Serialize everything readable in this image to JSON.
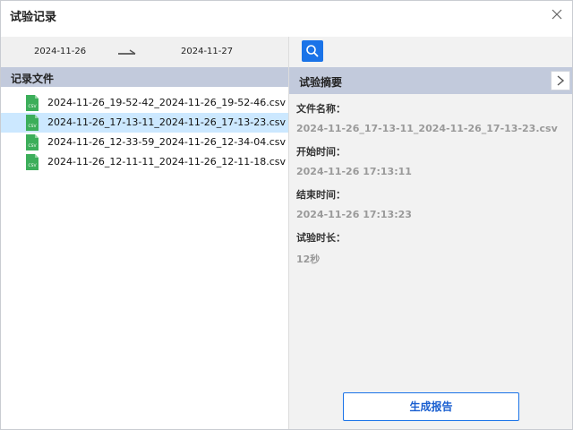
{
  "window": {
    "title": "试验记录"
  },
  "date_range": {
    "from": "2024-11-26",
    "to": "2024-11-27"
  },
  "left_panel": {
    "header": "记录文件",
    "files": [
      {
        "name": "2024-11-26_19-52-42_2024-11-26_19-52-46.csv",
        "selected": false
      },
      {
        "name": "2024-11-26_17-13-11_2024-11-26_17-13-23.csv",
        "selected": true
      },
      {
        "name": "2024-11-26_12-33-59_2024-11-26_12-34-04.csv",
        "selected": false
      },
      {
        "name": "2024-11-26_12-11-11_2024-11-26_12-11-18.csv",
        "selected": false
      }
    ]
  },
  "right_panel": {
    "header": "试验摘要",
    "fields": [
      {
        "label": "文件名称：",
        "value": "2024-11-26_17-13-11_2024-11-26_17-13-23.csv"
      },
      {
        "label": "开始时间：",
        "value": "2024-11-26 17:13:11"
      },
      {
        "label": "结束时间：",
        "value": "2024-11-26 17:13:23"
      },
      {
        "label": "试验时长：",
        "value": "12秒"
      }
    ],
    "report_button": "生成报告"
  },
  "icons": {
    "close": "close-icon",
    "search": "search-icon",
    "file": "csv-file-icon",
    "collapse": "chevron-right-icon"
  },
  "colors": {
    "accent": "#1a73e8",
    "header_bg": "#c2cadc",
    "selected_row": "#cce8ff",
    "csv_green": "#3cae5a"
  }
}
